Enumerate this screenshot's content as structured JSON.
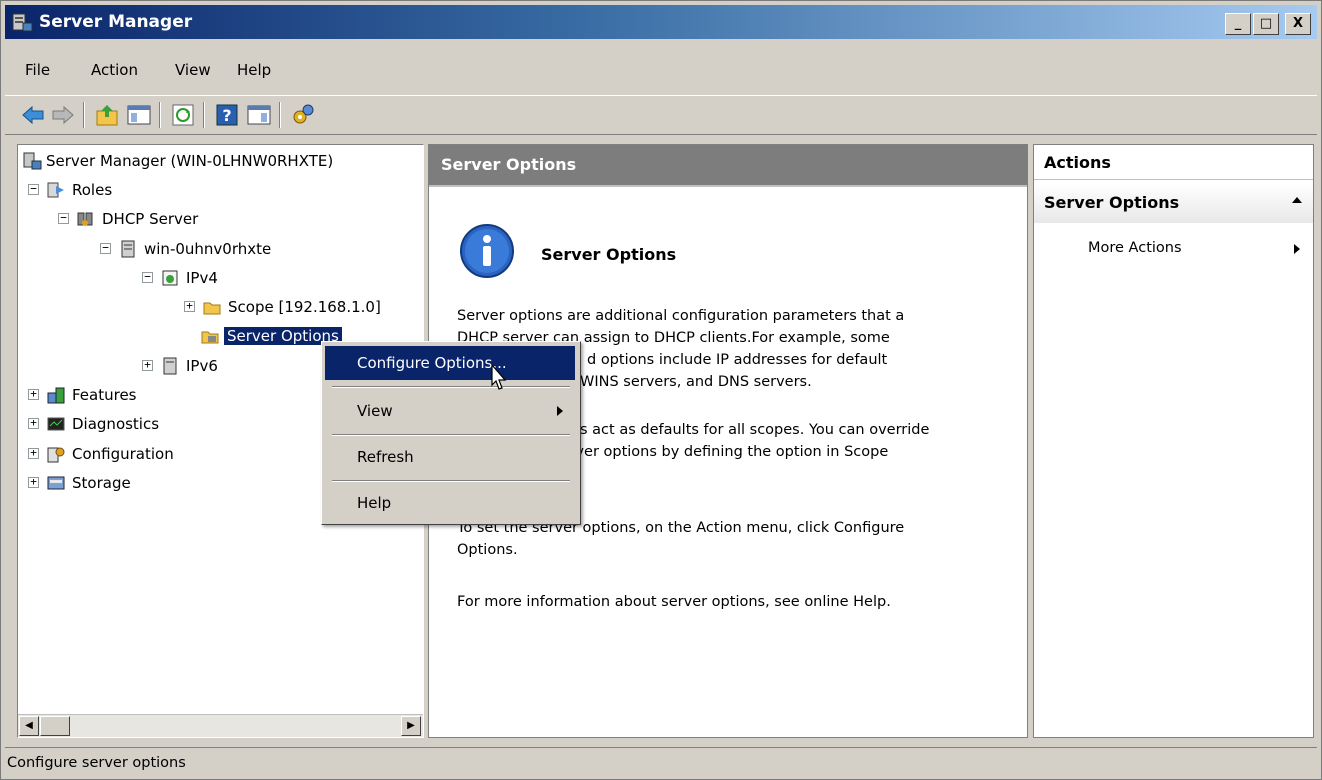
{
  "window": {
    "title": "Server Manager",
    "caption_buttons": [
      "_",
      "□",
      "X"
    ]
  },
  "menu": [
    "File",
    "Action",
    "View",
    "Help"
  ],
  "toolbar": {
    "icons": [
      "back-icon",
      "forward-icon",
      "up-folder-icon",
      "show-hide-tree-icon",
      "refresh-icon",
      "help-icon",
      "properties-icon",
      "configure-icon"
    ]
  },
  "tree": {
    "root": "Server Manager (WIN-0LHNW0RHXTE)",
    "roles": "Roles",
    "dhcp_server": "DHCP Server",
    "host": "win-0uhnv0rhxte",
    "ipv4": "IPv4",
    "scope": "Scope [192.168.1.0]",
    "server_options": "Server Options",
    "ipv6": "IPv6",
    "features": "Features",
    "diagnostics": "Diagnostics",
    "configuration": "Configuration",
    "storage": "Storage"
  },
  "center": {
    "header": "Server Options",
    "info_title": "Server Options",
    "p1_l1": "Server options are additional configuration parameters that a",
    "p1_l2": "DHCP server can assign to DHCP clients.For example, some",
    "p1_l3": "d options include IP addresses for default",
    "p1_l4": "ters), WINS servers, and DNS servers.",
    "p2_l1": "s act as defaults for all scopes.  You can override",
    "p2_l2": "server options by defining the option in Scope",
    "p3_l1": "To set the server options, on the Action menu, click Configure",
    "p3_l2": "Options.",
    "p4": "For more information about server options, see online Help."
  },
  "actions": {
    "header": "Actions",
    "group": "Server Options",
    "more": "More Actions"
  },
  "context_menu": {
    "configure": "Configure Options...",
    "view": "View",
    "refresh": "Refresh",
    "help": "Help"
  },
  "status": "Configure server options",
  "colors": {
    "selection": "#0a246a",
    "header_gray": "#7d7d7d",
    "chrome": "#d4d0c8"
  }
}
